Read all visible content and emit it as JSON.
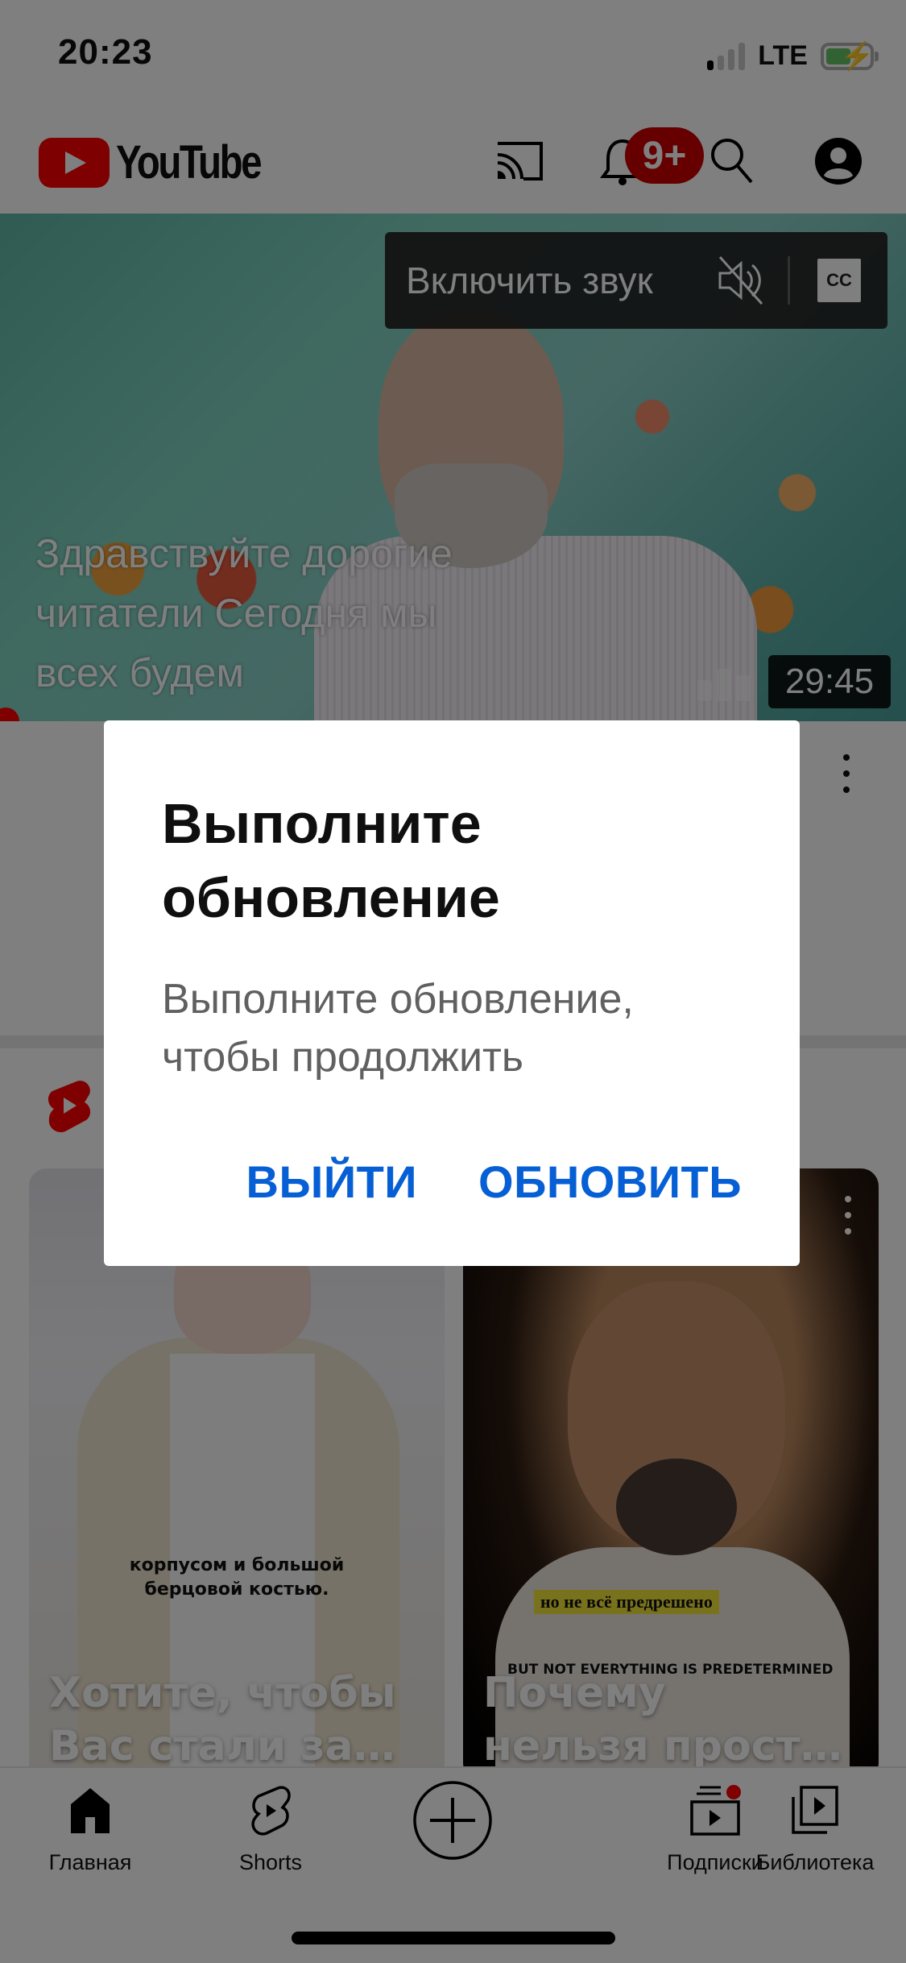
{
  "status_bar": {
    "time": "20:23",
    "network": "LTE",
    "signal_bars_active": 1,
    "signal_bars_total": 4,
    "battery_charging": true,
    "battery_color": "#65c466"
  },
  "header": {
    "logo_text": "YouTube",
    "brand_color": "#ff0000",
    "icons": [
      "cast-icon",
      "notifications-icon",
      "search-icon",
      "account-icon"
    ],
    "notification_badge": "9+"
  },
  "hero_video": {
    "mute_label": "Включить звук",
    "cc_label": "CC",
    "caption_lines": [
      "Здравствуйте дорогие",
      "читатели Сегодня мы",
      "всех будем"
    ],
    "duration": "29:45"
  },
  "shorts": {
    "cards": [
      {
        "subtitle_lines": [
          "корпусом и большой",
          "берцовой костью."
        ],
        "title_lines": [
          "Хотите, чтобы",
          "Вас стали за…"
        ]
      },
      {
        "subtitle_ru": "но не всё предрешено",
        "subtitle_en": "BUT NOT EVERYTHING IS PREDETERMINED",
        "title_lines": [
          "Почему",
          "нельзя прост…"
        ]
      }
    ]
  },
  "bottom_nav": {
    "items": [
      {
        "label": "Главная",
        "icon": "home-icon",
        "active": true
      },
      {
        "label": "Shorts",
        "icon": "shorts-icon"
      },
      {
        "label": "",
        "icon": "create-icon"
      },
      {
        "label": "Подписки",
        "icon": "subscriptions-icon",
        "has_dot": true
      },
      {
        "label": "Библиотека",
        "icon": "library-icon"
      }
    ]
  },
  "dialog": {
    "title": "Выполните обновление",
    "body": "Выполните обновление, чтобы продолжить",
    "exit_label": "ВЫЙТИ",
    "update_label": "ОБНОВИТЬ",
    "action_color": "#065fd4"
  }
}
